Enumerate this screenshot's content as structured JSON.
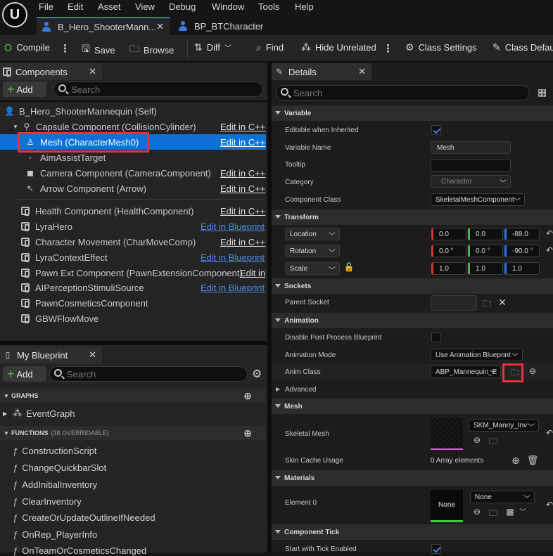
{
  "menu": [
    "File",
    "Edit",
    "Asset",
    "View",
    "Debug",
    "Window",
    "Tools",
    "Help"
  ],
  "tabs": [
    {
      "label": "B_Hero_ShooterMann...",
      "active": true
    },
    {
      "label": "BP_BTCharacter",
      "active": false
    }
  ],
  "toolbar": {
    "compile": "Compile",
    "save": "Save",
    "browse": "Browse",
    "diff": "Diff",
    "find": "Find",
    "hide_unrelated": "Hide Unrelated",
    "class_settings": "Class Settings",
    "class_defaults": "Class Defaults"
  },
  "components": {
    "tab_label": "Components",
    "add_label": "Add",
    "search_placeholder": "Search",
    "root": "B_Hero_ShooterMannequin (Self)",
    "items": [
      {
        "label": "Capsule Component (CollisionCylinder)",
        "edit": "Edit in C++"
      },
      {
        "label": "Mesh (CharacterMesh0)",
        "edit": "Edit in C++"
      },
      {
        "label": "AimAssistTarget",
        "edit": ""
      },
      {
        "label": "Camera Component (CameraComponent)",
        "edit": "Edit in C++"
      },
      {
        "label": "Arrow Component (Arrow)",
        "edit": "Edit in C++"
      },
      {
        "label": "Health Component (HealthComponent)",
        "edit": "Edit in C++"
      },
      {
        "label": "LyraHero",
        "edit": "Edit in Blueprint"
      },
      {
        "label": "Character Movement (CharMoveComp)",
        "edit": "Edit in C++"
      },
      {
        "label": "LyraContextEffect",
        "edit": "Edit in Blueprint"
      },
      {
        "label": "Pawn Ext Component (PawnExtensionComponent)",
        "edit": "Edit in"
      },
      {
        "label": "AIPerceptionStimuliSource",
        "edit": "Edit in Blueprint"
      },
      {
        "label": "PawnCosmeticsComponent",
        "edit": ""
      },
      {
        "label": "GBWFlowMove",
        "edit": ""
      }
    ]
  },
  "my_blueprint": {
    "tab_label": "My Blueprint",
    "add_label": "Add",
    "search_placeholder": "Search",
    "graphs_label": "GRAPHS",
    "event_graph": "EventGraph",
    "functions_label": "FUNCTIONS",
    "functions_count": "(38 OVERRIDABLE)",
    "functions": [
      "ConstructionScript",
      "ChangeQuickbarSlot",
      "AddInitialInventory",
      "ClearInventory",
      "CreateOrUpdateOutlineIfNeeded",
      "OnRep_PlayerInfo",
      "OnTeamOrCosmeticsChanged"
    ]
  },
  "details": {
    "tab_label": "Details",
    "search_placeholder": "Search",
    "sections": {
      "variable": "Variable",
      "transform": "Transform",
      "sockets": "Sockets",
      "animation": "Animation",
      "advanced": "Advanced",
      "mesh": "Mesh",
      "materials": "Materials",
      "component_tick": "Component Tick"
    },
    "variable": {
      "editable_label": "Editable when Inherited",
      "name_label": "Variable Name",
      "name_value": "Mesh",
      "tooltip_label": "Tooltip",
      "category_label": "Category",
      "category_value": "Character",
      "class_label": "Component Class",
      "class_value": "SkeletalMeshComponent"
    },
    "transform": {
      "location": {
        "label": "Location",
        "x": "0.0",
        "y": "0.0",
        "z": "-88.0"
      },
      "rotation": {
        "label": "Rotation",
        "x": "0.0 °",
        "y": "0.0 °",
        "z": "-90.0 °"
      },
      "scale": {
        "label": "Scale",
        "x": "1.0",
        "y": "1.0",
        "z": "1.0"
      }
    },
    "sockets": {
      "parent_label": "Parent Socket"
    },
    "animation": {
      "disable_pp_label": "Disable Post Process Blueprint",
      "mode_label": "Animation Mode",
      "mode_value": "Use Animation Blueprint",
      "class_label": "Anim Class",
      "class_value": "ABP_Mannequin_E"
    },
    "mesh": {
      "skeletal_label": "Skeletal Mesh",
      "skeletal_value": "SKM_Manny_Inv",
      "skin_cache_label": "Skin Cache Usage",
      "skin_cache_value": "0 Array elements"
    },
    "materials": {
      "element_label": "Element 0",
      "thumb_label": "None",
      "value": "None"
    },
    "tick": {
      "start_label": "Start with Tick Enabled"
    }
  }
}
